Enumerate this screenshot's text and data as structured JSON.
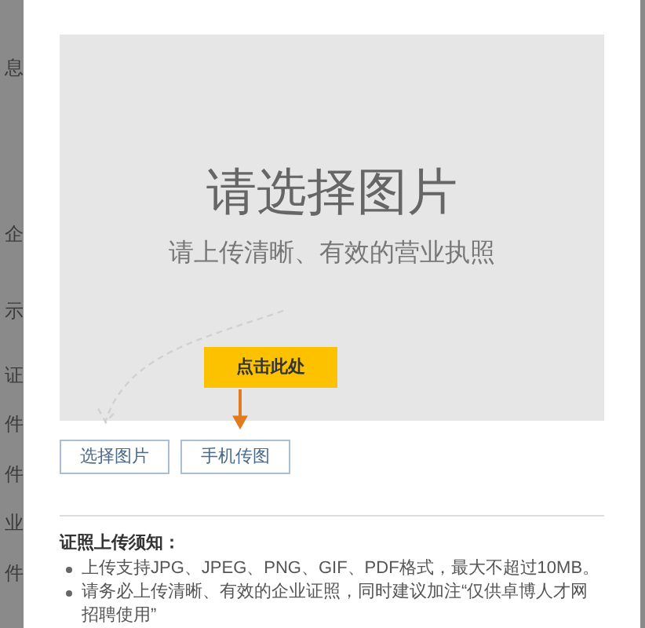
{
  "backdrop": {
    "fragments": [
      "息",
      "企",
      "示",
      "证",
      "件",
      "件",
      "业",
      "件"
    ]
  },
  "upload": {
    "title": "请选择图片",
    "subtitle": "请上传清晰、有效的营业执照",
    "hint_button": "点击此处"
  },
  "buttons": [
    {
      "label": "选择图片"
    },
    {
      "label": "手机传图"
    }
  ],
  "notice": {
    "title": "证照上传须知：",
    "items": [
      "上传支持JPG、JPEG、PNG、GIF、PDF格式，最大不超过10MB。",
      "请务必上传清晰、有效的企业证照，同时建议加注“仅供卓博人才网招聘使用”"
    ]
  }
}
